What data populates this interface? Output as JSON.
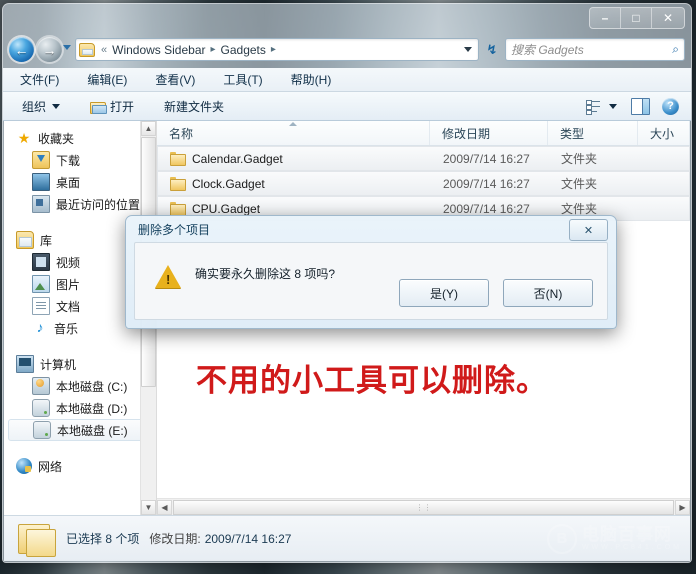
{
  "window": {
    "controls": {
      "minimize": "–",
      "maximize": "□",
      "close": "✕"
    }
  },
  "address_bar": {
    "back_glyph": "←",
    "forward_glyph": "→",
    "folder_prev_glyph": "«",
    "crumbs": [
      "Windows Sidebar",
      "Gadgets"
    ],
    "separator": "▸",
    "dropdown_glyph": "▾",
    "refresh_glyph": "↯"
  },
  "search": {
    "placeholder": "搜索 Gadgets",
    "icon": "search-icon",
    "icon_glyph": "⌕"
  },
  "menu": {
    "items": [
      {
        "label": "文件(F)"
      },
      {
        "label": "编辑(E)"
      },
      {
        "label": "查看(V)"
      },
      {
        "label": "工具(T)"
      },
      {
        "label": "帮助(H)"
      }
    ]
  },
  "toolbar": {
    "organize": "组织",
    "open": "打开",
    "new_folder": "新建文件夹",
    "caret_glyph": "▾",
    "help_glyph": "?"
  },
  "navigation_pane": {
    "groups": [
      {
        "header": {
          "label": "收藏夹",
          "icon": "star-icon"
        },
        "items": [
          {
            "label": "下载",
            "icon": "download-folder-icon"
          },
          {
            "label": "桌面",
            "icon": "desktop-icon"
          },
          {
            "label": "最近访问的位置",
            "icon": "recent-places-icon"
          }
        ]
      },
      {
        "header": {
          "label": "库",
          "icon": "library-icon"
        },
        "items": [
          {
            "label": "视频",
            "icon": "video-icon"
          },
          {
            "label": "图片",
            "icon": "pictures-icon"
          },
          {
            "label": "文档",
            "icon": "documents-icon"
          },
          {
            "label": "音乐",
            "icon": "music-icon"
          }
        ]
      },
      {
        "header": {
          "label": "计算机",
          "icon": "computer-icon"
        },
        "items": [
          {
            "label": "本地磁盘 (C:)",
            "icon": "system-drive-icon",
            "selected": false
          },
          {
            "label": "本地磁盘 (D:)",
            "icon": "drive-icon",
            "selected": false
          },
          {
            "label": "本地磁盘 (E:)",
            "icon": "drive-icon",
            "selected": true
          }
        ]
      },
      {
        "header": {
          "label": "网络",
          "icon": "network-icon"
        },
        "items": []
      }
    ]
  },
  "file_list": {
    "columns": [
      "名称",
      "修改日期",
      "类型",
      "大小"
    ],
    "sorted_column": "名称",
    "rows": [
      {
        "name": "Calendar.Gadget",
        "date": "2009/7/14 16:27",
        "type": "文件夹",
        "size": "",
        "selected": true
      },
      {
        "name": "Clock.Gadget",
        "date": "2009/7/14 16:27",
        "type": "文件夹",
        "size": "",
        "selected": true
      },
      {
        "name": "CPU.Gadget",
        "date": "2009/7/14 16:27",
        "type": "文件夹",
        "size": "",
        "selected": true
      }
    ]
  },
  "annotation": {
    "text": "不用的小工具可以删除。",
    "color": "#d01a1a"
  },
  "status_bar": {
    "selected_label": "已选择 8 个项",
    "date_label": "修改日期:",
    "date_value": "2009/7/14 16:27"
  },
  "watermark": {
    "mark": "B",
    "title": "电脑百事网",
    "url": "WWW.PC841.COM"
  },
  "dialog": {
    "title": "删除多个项目",
    "close_glyph": "✕",
    "message": "确实要永久删除这 8 项吗?",
    "warning_glyph": "!",
    "buttons": [
      {
        "label": "是(Y)",
        "name": "yes-button"
      },
      {
        "label": "否(N)",
        "name": "no-button"
      }
    ]
  },
  "scrollbars": {
    "up_glyph": "▲",
    "down_glyph": "▼",
    "left_glyph": "◀",
    "right_glyph": "▶",
    "grip_glyph": "⋮⋮"
  }
}
